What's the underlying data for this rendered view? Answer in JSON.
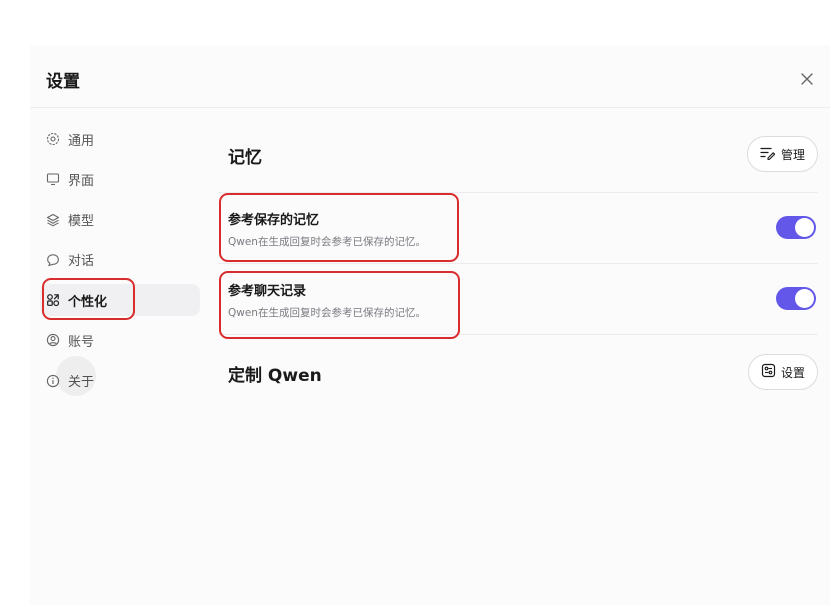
{
  "dialog": {
    "title": "设置"
  },
  "sidebar": {
    "items": [
      {
        "label": "通用",
        "icon": "gear-icon"
      },
      {
        "label": "界面",
        "icon": "monitor-icon"
      },
      {
        "label": "模型",
        "icon": "layers-icon"
      },
      {
        "label": "对话",
        "icon": "chat-bubble-icon"
      },
      {
        "label": "个性化",
        "icon": "personalize-grid-icon",
        "active": true
      },
      {
        "label": "账号",
        "icon": "user-circle-icon"
      },
      {
        "label": "关于",
        "icon": "info-icon"
      }
    ]
  },
  "memory": {
    "title": "记忆",
    "manage_label": "管理",
    "settings": [
      {
        "title": "参考保存的记忆",
        "desc": "Qwen在生成回复时会参考已保存的记忆。",
        "enabled": true
      },
      {
        "title": "参考聊天记录",
        "desc": "Qwen在生成回复时会参考已保存的记忆。",
        "enabled": true
      }
    ]
  },
  "customize": {
    "title": "定制 Qwen",
    "settings_label": "设置"
  },
  "colors": {
    "accent": "#6257e8",
    "highlight": "#d92d2d"
  }
}
